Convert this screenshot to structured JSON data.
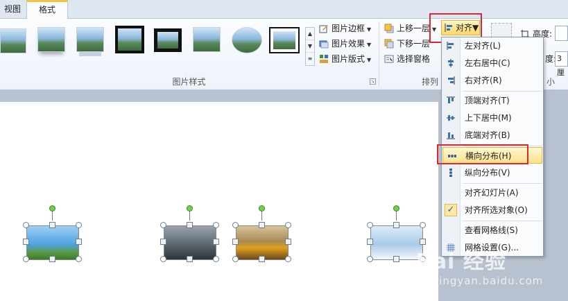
{
  "tabs": {
    "view": "视图",
    "format": "格式"
  },
  "picture_styles": {
    "group_label": "图片样式",
    "border": "图片边框",
    "effects": "图片效果",
    "layout": "图片版式"
  },
  "arrange": {
    "group_label": "排列",
    "bring_forward": "上移一层",
    "send_backward": "下移一层",
    "selection_pane": "选择窗格",
    "align": "对齐"
  },
  "size": {
    "group_label_partial": "小",
    "height_label": "高度:",
    "width_label": "度:",
    "width_value": "3 厘"
  },
  "align_menu": {
    "items": [
      {
        "label": "左对齐(L)",
        "icon": "align-left-icon"
      },
      {
        "label": "左右居中(C)",
        "icon": "align-center-icon"
      },
      {
        "label": "右对齐(R)",
        "icon": "align-right-icon"
      },
      {
        "label": "顶端对齐(T)",
        "icon": "align-top-icon"
      },
      {
        "label": "上下居中(M)",
        "icon": "align-middle-icon"
      },
      {
        "label": "底端对齐(B)",
        "icon": "align-bottom-icon"
      },
      {
        "label": "横向分布(H)",
        "icon": "distribute-horizontal-icon",
        "highlighted": true
      },
      {
        "label": "纵向分布(V)",
        "icon": "distribute-vertical-icon"
      },
      {
        "label": "对齐幻灯片(A)",
        "icon": ""
      },
      {
        "label": "对齐所选对象(O)",
        "icon": "check-icon",
        "checked": true
      },
      {
        "label": "查看网格线(S)",
        "icon": ""
      },
      {
        "label": "网格设置(G)...",
        "icon": "grid-icon"
      }
    ]
  },
  "watermark": {
    "line1": "Bai 经验",
    "line2": "jingyan.baidu.com"
  },
  "colors": {
    "highlight_red": "#e0262a",
    "accent_yellow": "#fcd86a"
  }
}
